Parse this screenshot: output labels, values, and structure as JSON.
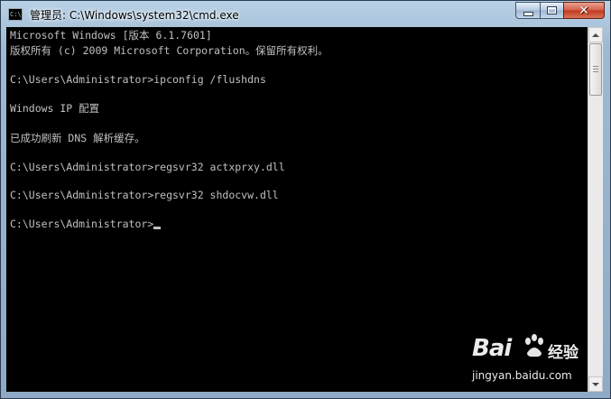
{
  "window": {
    "title": "管理员: C:\\Windows\\system32\\cmd.exe",
    "app_icon_text": "C:\\",
    "close_glyph": "✕"
  },
  "console": {
    "lines": [
      "Microsoft Windows [版本 6.1.7601]",
      "版权所有 (c) 2009 Microsoft Corporation。保留所有权利。",
      "",
      "C:\\Users\\Administrator>ipconfig /flushdns",
      "",
      "Windows IP 配置",
      "",
      "已成功刷新 DNS 解析缓存。",
      "",
      "C:\\Users\\Administrator>regsvr32 actxprxy.dll",
      "",
      "C:\\Users\\Administrator>regsvr32 shdocvw.dll",
      "",
      "C:\\Users\\Administrator>"
    ],
    "text_color": "#c0c0c0",
    "background_color": "#000000"
  },
  "watermark": {
    "brand": "Bai",
    "brand_suffix": "经验",
    "url": "jingyan.baidu.com"
  }
}
